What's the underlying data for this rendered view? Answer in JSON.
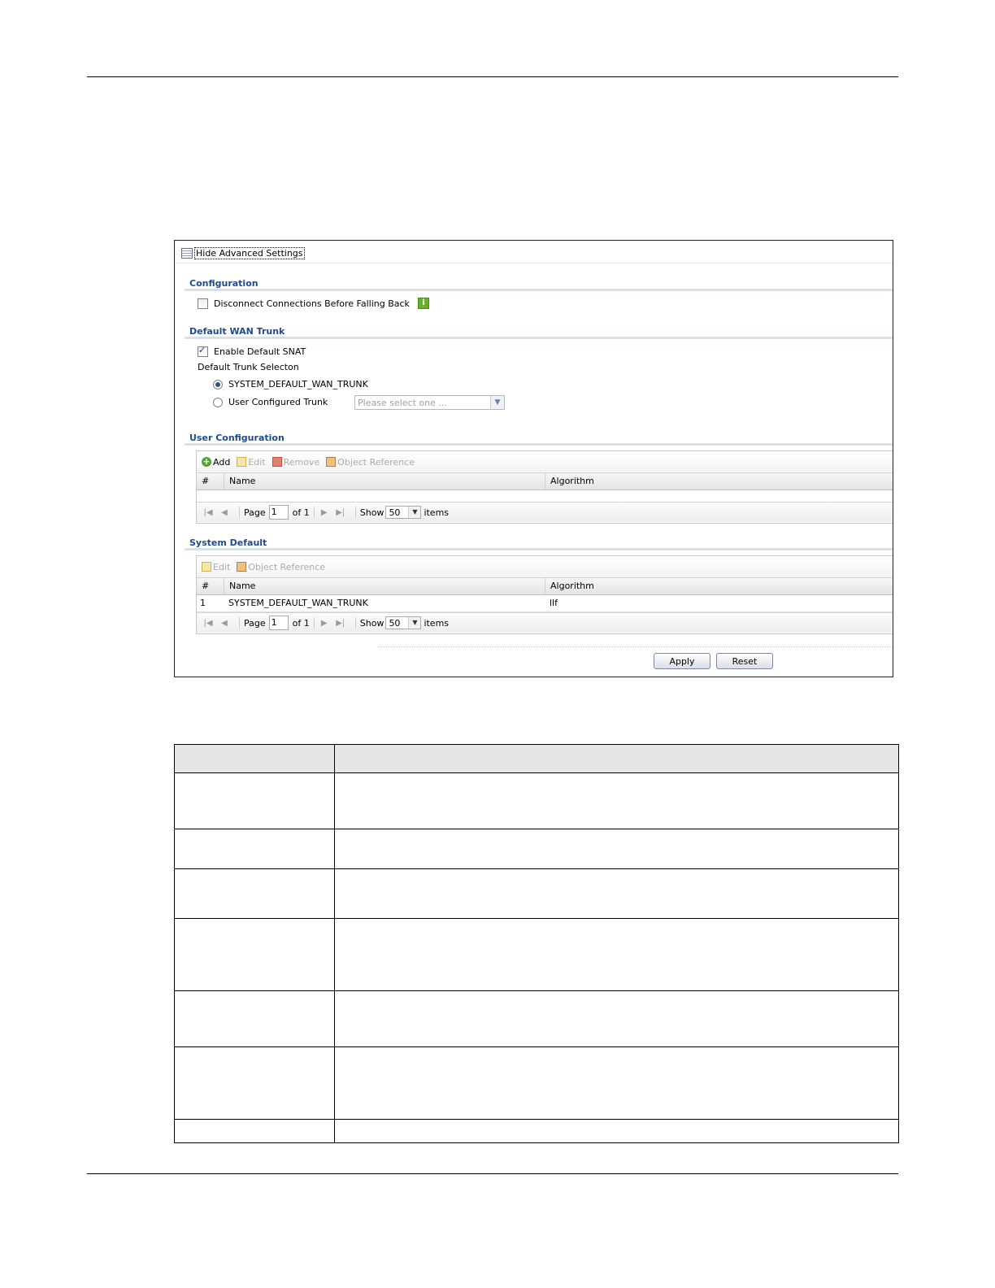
{
  "toggle": {
    "label": "Hide Advanced Settings",
    "icon": "settings-list-icon"
  },
  "configuration": {
    "title": "Configuration",
    "disconnect_label": "Disconnect Connections Before Falling Back",
    "disconnect_checked": false,
    "info_icon": "i"
  },
  "default_wan_trunk": {
    "title": "Default WAN Trunk",
    "enable_snat_label": "Enable Default SNAT",
    "enable_snat_checked": true,
    "selection_label": "Default Trunk Selecton",
    "option_system": "SYSTEM_DEFAULT_WAN_TRUNK",
    "option_user": "User Configured Trunk",
    "selected_option": "system",
    "select_placeholder": "Please select one ..."
  },
  "user_configuration": {
    "title": "User Configuration",
    "toolbar": {
      "add": "Add",
      "edit": "Edit",
      "remove": "Remove",
      "object_reference": "Object Reference"
    },
    "columns": [
      "#",
      "Name",
      "Algorithm"
    ],
    "rows": [],
    "pager": {
      "page_label": "Page",
      "page": "1",
      "of_label": "of 1",
      "show_label": "Show",
      "show_value": "50",
      "items_label": "items"
    }
  },
  "system_default": {
    "title": "System Default",
    "toolbar": {
      "edit": "Edit",
      "object_reference": "Object Reference"
    },
    "columns": [
      "#",
      "Name",
      "Algorithm"
    ],
    "rows": [
      {
        "num": "1",
        "name": "SYSTEM_DEFAULT_WAN_TRUNK",
        "algorithm": "llf"
      }
    ],
    "pager": {
      "page_label": "Page",
      "page": "1",
      "of_label": "of 1",
      "show_label": "Show",
      "show_value": "50",
      "items_label": "items"
    }
  },
  "buttons": {
    "apply": "Apply",
    "reset": "Reset"
  },
  "colors": {
    "section_title": "#1f4a8c",
    "section_bar": "#d9e0e8",
    "add_icon": "#55a030"
  }
}
